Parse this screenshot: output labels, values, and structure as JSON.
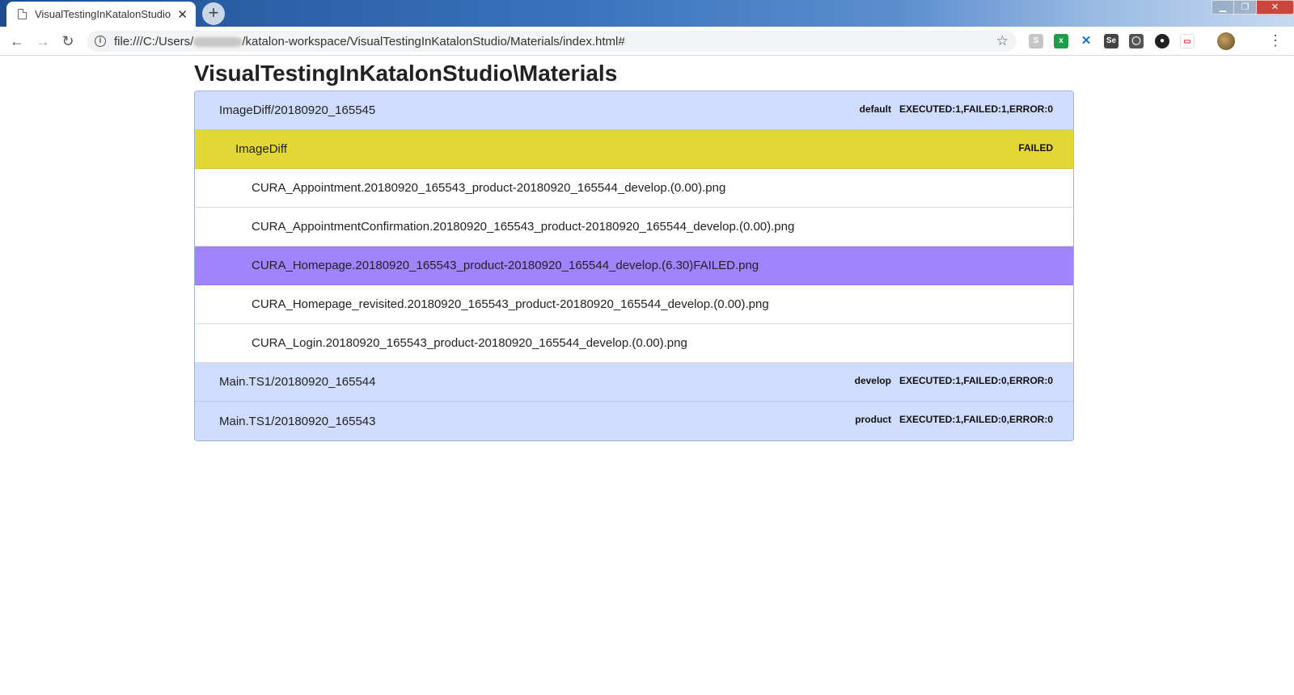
{
  "browser": {
    "tab_title": "VisualTestingInKatalonStudio\\",
    "url_prefix": "file:///C:/Users/",
    "url_suffix": "/katalon-workspace/VisualTestingInKatalonStudio/Materials/index.html#",
    "tab_close": "✕",
    "new_tab": "+",
    "back": "←",
    "forward": "→",
    "reload": "↻",
    "star": "☆",
    "menu": "⋮",
    "extensions": [
      "S",
      "x",
      "✕",
      "Se",
      "◯",
      "●",
      "▭",
      "avatar"
    ]
  },
  "page": {
    "title": "VisualTestingInKatalonStudio\\Materials"
  },
  "tree": {
    "suites": [
      {
        "label": "ImageDiff/20180920_165545",
        "profile": "default",
        "stats": "EXECUTED:1,FAILED:1,ERROR:0"
      },
      {
        "label": "Main.TS1/20180920_165544",
        "profile": "develop",
        "stats": "EXECUTED:1,FAILED:0,ERROR:0"
      },
      {
        "label": "Main.TS1/20180920_165543",
        "profile": "product",
        "stats": "EXECUTED:1,FAILED:0,ERROR:0"
      }
    ],
    "testcase": {
      "label": "ImageDiff",
      "status": "FAILED"
    },
    "files": [
      "CURA_Appointment.20180920_165543_product-20180920_165544_develop.(0.00).png",
      "CURA_AppointmentConfirmation.20180920_165543_product-20180920_165544_develop.(0.00).png",
      "CURA_Homepage.20180920_165543_product-20180920_165544_develop.(6.30)FAILED.png",
      "CURA_Homepage_revisited.20180920_165543_product-20180920_165544_develop.(0.00).png",
      "CURA_Login.20180920_165543_product-20180920_165544_develop.(0.00).png"
    ]
  },
  "colors": {
    "suite_bg": "#cfdcfb",
    "testcase_bg": "#e3d736",
    "failed_file_bg": "#9f84fd"
  }
}
